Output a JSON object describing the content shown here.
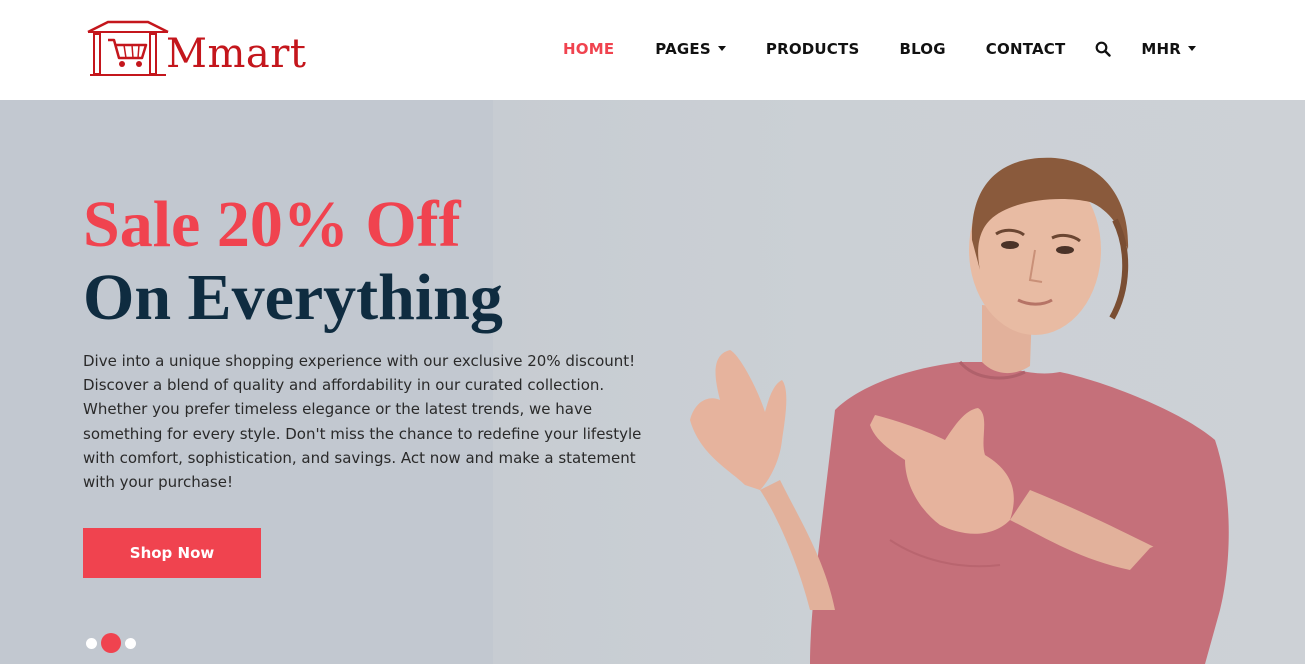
{
  "brand": {
    "name": "Mmart",
    "color": "#c4161c"
  },
  "nav": {
    "items": [
      {
        "label": "HOME",
        "active": true
      },
      {
        "label": "PAGES",
        "dropdown": true
      },
      {
        "label": "PRODUCTS"
      },
      {
        "label": "BLOG"
      },
      {
        "label": "CONTACT"
      }
    ],
    "search_icon": "search-icon",
    "currency": {
      "label": "MHR",
      "dropdown": true
    }
  },
  "hero": {
    "headline_line1": "Sale 20% Off",
    "headline_line2": "On Everything",
    "description": "Dive into a unique shopping experience with our exclusive 20% discount! Discover a blend of quality and affordability in our curated collection. Whether you prefer timeless elegance or the latest trends, we have something for every style. Don't miss the chance to redefine your lifestyle with comfort, sophistication, and savings. Act now and make a statement with your purchase!",
    "cta_label": "Shop Now",
    "carousel": {
      "slides": 3,
      "active_index": 1
    }
  },
  "colors": {
    "accent": "#f0434f",
    "headline_dark": "#0f2c40",
    "hero_bg": "#c2c8d0"
  }
}
